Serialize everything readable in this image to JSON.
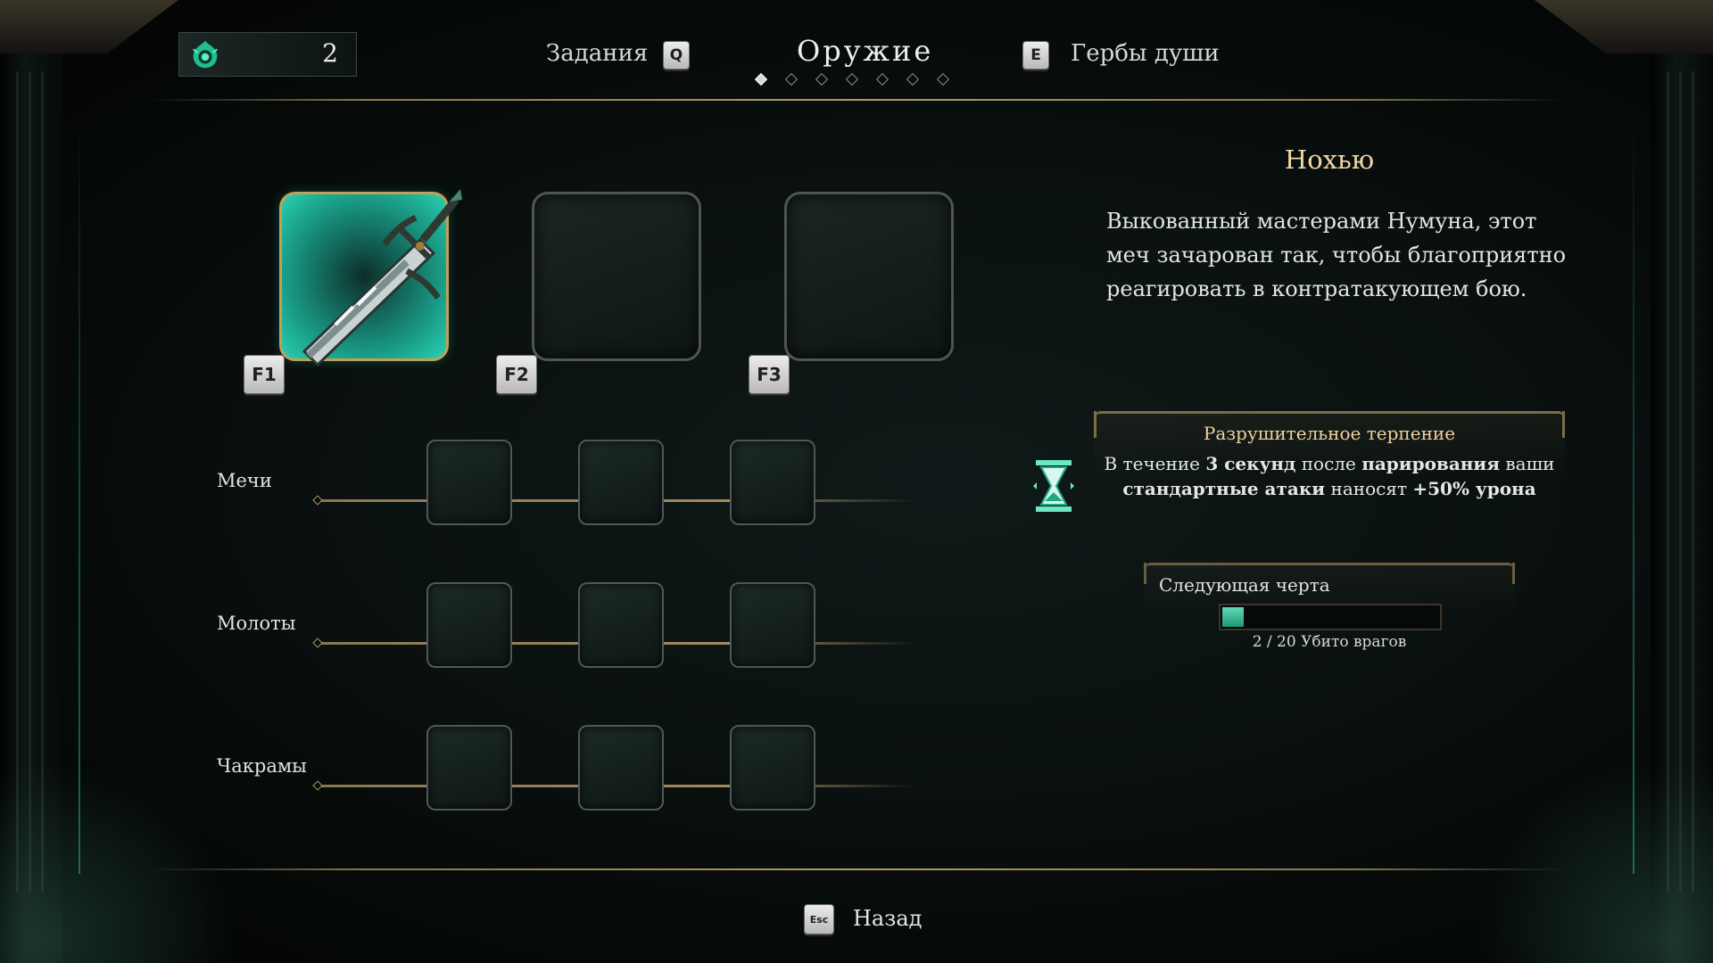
{
  "currency": {
    "icon": "soul-flame-icon",
    "amount": "2"
  },
  "nav": {
    "left_label": "Задания",
    "left_key": "Q",
    "title": "Оружие",
    "right_key": "E",
    "right_label": "Гербы души",
    "page_dots_total": 7,
    "page_dots_active": 1
  },
  "weapon_slots": [
    {
      "key": "F1",
      "state": "equipped",
      "icon": "sword-icon"
    },
    {
      "key": "F2",
      "state": "empty"
    },
    {
      "key": "F3",
      "state": "empty"
    }
  ],
  "categories": [
    {
      "label": "Мечи",
      "slots": 3
    },
    {
      "label": "Молоты",
      "slots": 3
    },
    {
      "label": "Чакрамы",
      "slots": 3
    }
  ],
  "weapon": {
    "name": "Нохью",
    "description": "Выкованный мастерами Нумуна, этот меч зачарован так, чтобы благоприятно реагировать в контратакующем бою."
  },
  "trait": {
    "icon": "hourglass-icon",
    "name": "Разрушительное терпение",
    "t1": "В течение ",
    "b1": "3 секунд",
    "t2": " после ",
    "b2": "парирования",
    "t3": " ваши ",
    "b3": "стандартные атаки",
    "t4": " наносят ",
    "b4": "+50% урона"
  },
  "next_trait": {
    "label": "Следующая черта",
    "progress_current": 2,
    "progress_total": 20,
    "progress_text": "2 / 20 Убито врагов"
  },
  "footer": {
    "back_key": "Esc",
    "back_label": "Назад"
  },
  "colors": {
    "accent_teal": "#2cd0b2",
    "gold": "#b39a66",
    "title_gold": "#f2d7a6"
  }
}
